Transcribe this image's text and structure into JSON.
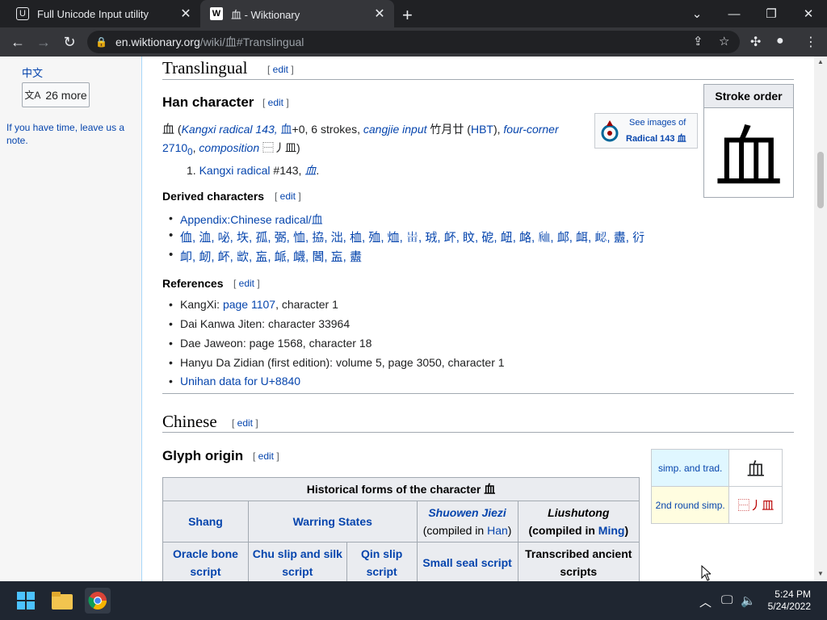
{
  "browser": {
    "tabs": [
      {
        "title": "Full Unicode Input utility",
        "favicon": "unicode-utility-favicon",
        "active": false
      },
      {
        "title": "血 - Wiktionary",
        "favicon": "wiktionary-favicon",
        "active": true
      }
    ],
    "url_host": "en.wiktionary.org",
    "url_path": "/wiki/血#Translingual"
  },
  "sidebar": {
    "lang_label": "中文",
    "more_label": "26 more",
    "note": "If you have time, leave us a note."
  },
  "translingual": {
    "heading": "Translingual",
    "edit": "edit",
    "han_heading": "Han character",
    "han_line_char": "血",
    "han_line_parts": {
      "kangxi": "Kangxi radical 143,",
      "radical_plus": "血",
      "plus_text": "+0, 6 strokes,",
      "cangjie": "cangjie input",
      "cangjie_val": "竹月廿",
      "hbt": "(HBT),",
      "four_corner": "four-corner",
      "fc_val": "2710",
      "fc_sub": "0",
      "composition": "composition",
      "comp_val": "⿱丿皿)"
    },
    "def_num": "1.",
    "def_link": "Kangxi radical",
    "def_rest": "#143,",
    "def_glyph": "⾎",
    "commons": {
      "line1": "See images of",
      "line2": "Radical 143 血"
    },
    "stroke_order_title": "Stroke order",
    "stroke_glyph": "血",
    "derived_heading": "Derived characters",
    "derived": [
      "Appendix:Chinese radical/血",
      "侐, 洫, 咇, 垁, 孤, 弻, 恤, 拹, 泏, 桖, 殈, 烅, 𤰫, 珬, 衃, 盿, 砨, 衄, 衉, 𧖴, 䘏, 衈, 𧖷, 衋, 𧗠",
      "卹, 衂, 衃, 欪, 衁, 衇, 衊, 閪, 衁, 衋"
    ],
    "references_heading": "References",
    "references": [
      {
        "pre": "KangXi: ",
        "link": "page 1107",
        "post": ", character 1"
      },
      {
        "pre": "Dai Kanwa Jiten: character 33964",
        "link": "",
        "post": ""
      },
      {
        "pre": "Dae Jaweon: page 1568, character 18",
        "link": "",
        "post": ""
      },
      {
        "pre": "Hanyu Da Zidian (first edition): volume 5, page 3050, character 1",
        "link": "",
        "post": ""
      },
      {
        "pre": "",
        "link": "Unihan data for U+8840",
        "post": ""
      }
    ]
  },
  "chinese": {
    "heading": "Chinese",
    "edit": "edit",
    "glyph_origin": "Glyph origin",
    "simp_table": [
      {
        "label": "simp. and trad.",
        "value": "血"
      },
      {
        "label": "2nd round simp.",
        "value": "⿱丿皿"
      }
    ],
    "hist_title": "Historical forms of the character 血",
    "hist_headers": {
      "shang": "Shang",
      "warring": "Warring States",
      "shuowen": "Shuowen Jiezi",
      "shuowen_sub_pre": "(compiled in ",
      "shuowen_sub_link": "Han",
      "shuowen_sub_post": ")",
      "liushutong": "Liushutong",
      "liu_sub_pre": "(compiled in ",
      "liu_sub_link": "Ming",
      "liu_sub_post": ")"
    },
    "hist_row2": [
      "Oracle bone script",
      "Chu slip and silk script",
      "Qin slip script",
      "Small seal script",
      "Transcribed ancient scripts"
    ]
  },
  "taskbar": {
    "time": "5:24 PM",
    "date": "5/24/2022"
  }
}
